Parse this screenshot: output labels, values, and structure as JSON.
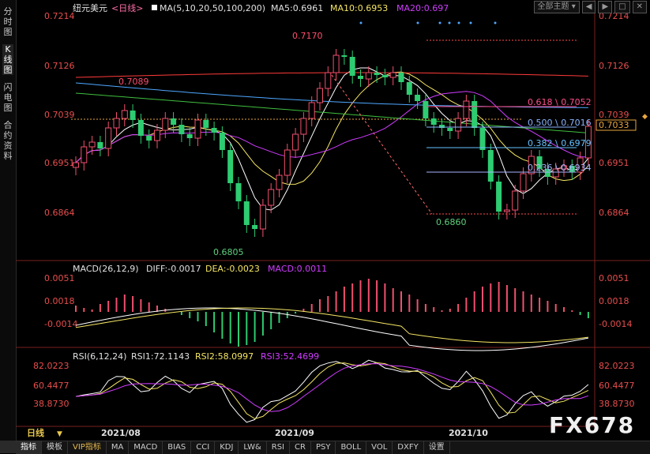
{
  "left_tabs": [
    "分时图",
    "K线图",
    "闪电图",
    "合约资料"
  ],
  "top_buttons": {
    "theme_label": "全部主题"
  },
  "header": {
    "symbol": "纽元美元",
    "period": "<日线>",
    "ma_params": "MA(5,10,20,50,100,200)",
    "ma5": "MA5:0.6961",
    "ma10": "MA10:0.6953",
    "ma20": "MA20:0.697"
  },
  "price_axis": {
    "ticks": [
      "0.7214",
      "0.7126",
      "0.7039",
      "0.6951",
      "0.6864"
    ],
    "current_price": "0.7033"
  },
  "annotations": {
    "high_mid": "0.7170",
    "high_left": "0.7089",
    "low_left": "0.6805",
    "low_right": "0.6860",
    "fib": [
      "0.618 \\ 0.7052",
      "0.500 \\ 0.7016",
      "0.382 \\ 0.6979",
      "0.236 \\ 0.6934"
    ]
  },
  "macd": {
    "label": "MACD(26,12,9)",
    "diff": "DIFF:-0.0017",
    "dea": "DEA:-0.0023",
    "macd": "MACD:0.0011",
    "ticks": [
      "0.0051",
      "0.0018",
      "-0.0014"
    ]
  },
  "rsi": {
    "label": "RSI(6,12,24)",
    "rsi1": "RSI1:72.1143",
    "rsi2": "RSI2:58.0997",
    "rsi3": "RSI3:52.4699",
    "ticks": [
      "82.0223",
      "60.4477",
      "38.8730"
    ]
  },
  "x_axis": {
    "period_label": "日线",
    "labels": [
      "2021/08",
      "2021/09",
      "2021/10"
    ]
  },
  "watermark": "FX678",
  "bottom_tabs": [
    "指标",
    "模板",
    "VIP指标",
    "MA",
    "MACD",
    "BIAS",
    "CCI",
    "KDJ",
    "LW&",
    "RSI",
    "CR",
    "PSY",
    "BOLL",
    "VOL",
    "DXFY",
    "设置"
  ],
  "colors": {
    "up": "#f0506e",
    "down": "#2ecc71",
    "ma5": "#ffffff",
    "ma10": "#f5e663",
    "ma20": "#d03cff",
    "ma50": "#3fbf3f",
    "ma100": "#4ea7ff",
    "ma200": "#ff3a3a",
    "fib618": "#ff4d8d",
    "fib500": "#8ab4ff",
    "fib382": "#66c2ff",
    "fib236": "#a8b4ff",
    "text": "#cfcfcf",
    "axis": "#e84d4d"
  }
}
